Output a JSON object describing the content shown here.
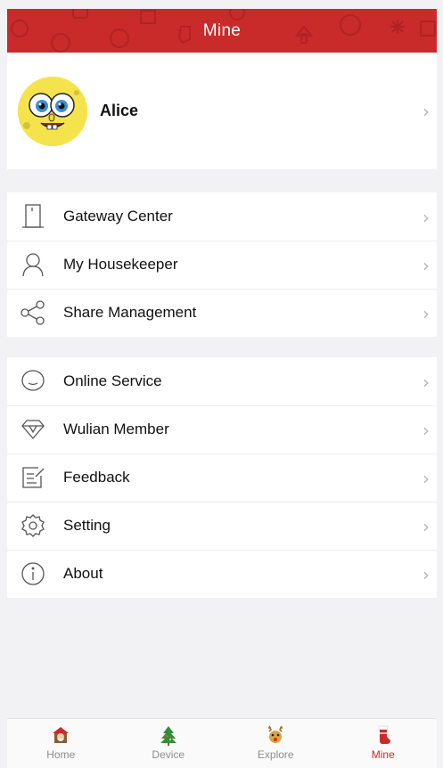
{
  "header": {
    "title": "Mine",
    "color": "#c92a2a"
  },
  "profile": {
    "name": "Alice",
    "avatar_icon": "sponge-character-avatar"
  },
  "menu_groups": [
    [
      {
        "label": "Gateway Center",
        "icon": "door-icon"
      },
      {
        "label": "My Housekeeper",
        "icon": "person-icon"
      },
      {
        "label": "Share Management",
        "icon": "share-icon"
      }
    ],
    [
      {
        "label": "Online Service",
        "icon": "chat-bubble-icon"
      },
      {
        "label": "Wulian Member",
        "icon": "diamond-icon"
      },
      {
        "label": "Feedback",
        "icon": "edit-note-icon"
      },
      {
        "label": "Setting",
        "icon": "gear-icon"
      },
      {
        "label": "About",
        "icon": "info-icon"
      }
    ]
  ],
  "tabs": [
    {
      "label": "Home",
      "icon": "santa-house-icon",
      "active": false
    },
    {
      "label": "Device",
      "icon": "christmas-tree-icon",
      "active": false
    },
    {
      "label": "Explore",
      "icon": "reindeer-icon",
      "active": false
    },
    {
      "label": "Mine",
      "icon": "stocking-icon",
      "active": true
    }
  ],
  "chevron": "›"
}
